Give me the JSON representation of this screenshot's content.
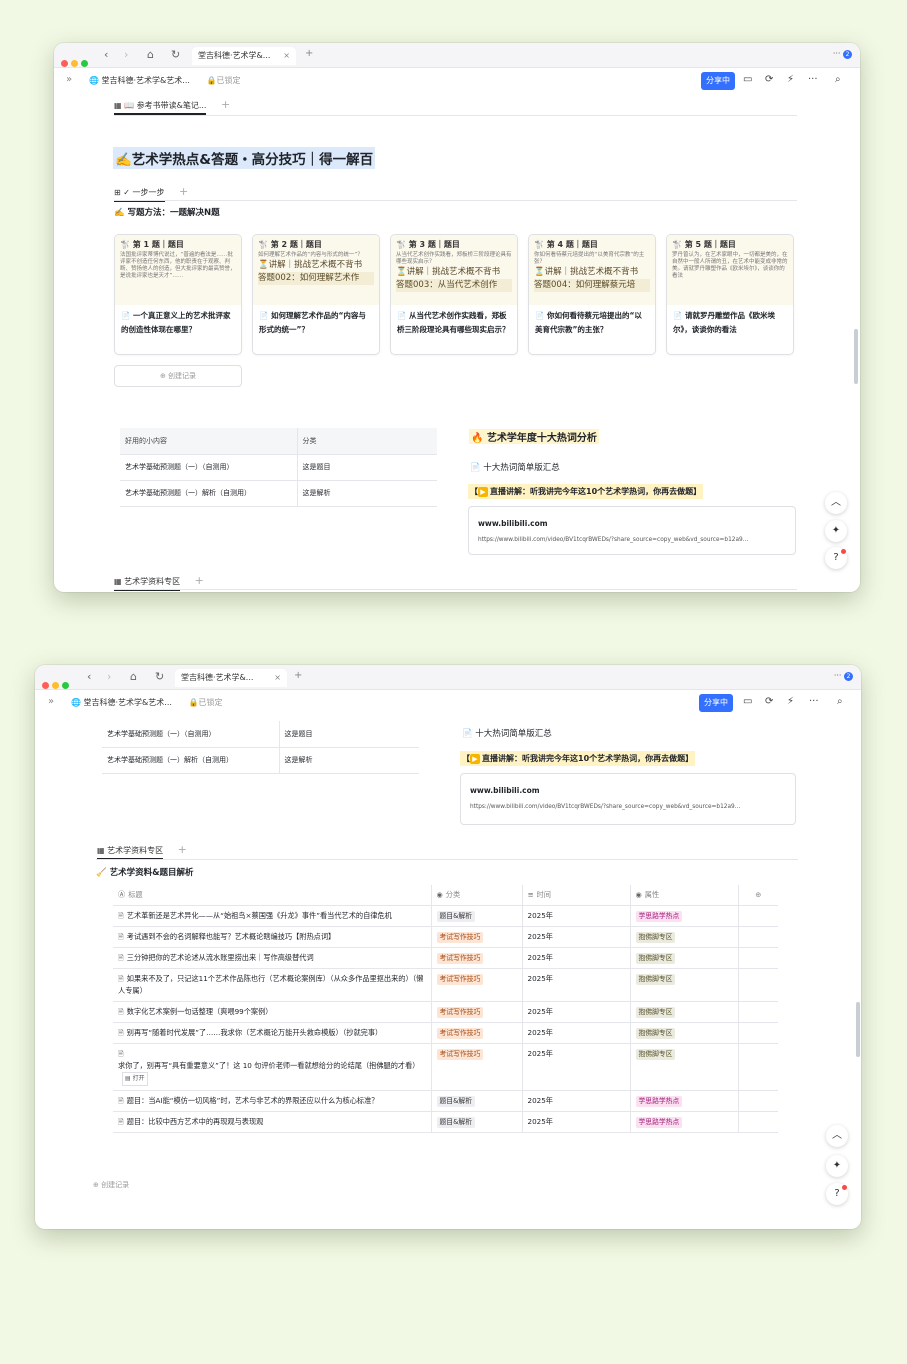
{
  "browser": {
    "tab_title": "堂吉科德·艺术学&...",
    "tab_title_2": "堂吉科德·艺术学&...",
    "notif_count": "2"
  },
  "toolbar": {
    "breadcrumb": "堂吉科德·艺术学&艺术...",
    "breadcrumb_2": "堂吉科德·艺术学&艺术...",
    "locked": "已锁定",
    "share": "分享中"
  },
  "window1": {
    "top_tab": "📖 参考书带读&笔记...",
    "title": "✍️艺术学热点&答题・高分技巧｜得一解百",
    "view_tab": "✓ 一步一步",
    "method": "✍️ 写题方法：一题解决N题",
    "cards": [
      {
        "head": "🐩 第 1 题｜题目",
        "text": "法国批评家蒂博代说过，“普遍的看法是……批评家不创造任何东西，他的职责在于观察、判断、赞扬他人的创造，但大批评家的最高赞誉，是说批评家也是天才”……",
        "big": "",
        "big2": "",
        "title": "📄 一个真正意义上的艺术批评家的创造性体现在哪里？"
      },
      {
        "head": "🐩 第 2 题｜题目",
        "text": "如何理解艺术作品的“内容与形式的统一”？",
        "big": "⏳讲解｜挑战艺术概不背书",
        "big2": "答题002：如何理解艺术作",
        "title": "📄 如何理解艺术作品的“内容与形式的统一”？"
      },
      {
        "head": "🐩 第 3 题｜题目",
        "text": "从当代艺术创作实践看，郑板桥三阶段理论具有哪些现实启示？",
        "big": "⏳讲解｜挑战艺术概不背书",
        "big2": "答题003：从当代艺术创作",
        "title": "📄 从当代艺术创作实践看，郑板桥三阶段理论具有哪些现实启示？"
      },
      {
        "head": "🐩 第 4 题｜题目",
        "text": "你如何看待蔡元培提出的“以美育代宗教”的主张？",
        "big": "⏳讲解｜挑战艺术概不背书",
        "big2": "答题004：如何理解蔡元培",
        "title": "📄 你如何看待蔡元培提出的“以美育代宗教”的主张？"
      },
      {
        "head": "🐩 第 5 题｜题目",
        "text": "罗丹曾认为，在艺术家眼中，一切都是美的，在自然中一般人所谓的丑，在艺术中能变成非常的美。请就罗丹雕塑作品《欧米埃尔》，谈谈你的看法",
        "big": "",
        "big2": "",
        "title": "📄 请就罗丹雕塑作品《欧米埃尔》，谈谈你的看法"
      }
    ],
    "create": "⊕ 创建记录",
    "mini_table": {
      "headers": [
        "好用的小内容",
        "分类"
      ],
      "rows": [
        [
          "艺术学基础预测题（一）（自测用）",
          "这是题目"
        ],
        [
          "艺术学基础预测题（一）解析（自测用）",
          "这是解析"
        ]
      ]
    },
    "hot_title": "🔥 艺术学年度十大热词分析",
    "doc_line": "📄 十大热词简单版汇总",
    "live": "直播讲解：听我讲完今年这10个艺术学热词，你再去做题】",
    "live_prefix": "【",
    "link_domain": "www.bilibili.com",
    "link_url": "https://www.bilibili.com/video/BV1tcqrBWEDs/?share_source=copy_web&vd_source=b12a9...",
    "bottom_tab": "艺术学资料专区"
  },
  "window2": {
    "mini_rows": [
      [
        "艺术学基础预测题（一）（自测用）",
        "这是题目"
      ],
      [
        "艺术学基础预测题（一）解析（自测用）",
        "这是解析"
      ]
    ],
    "doc_line": "📄 十大热词简单版汇总",
    "live_prefix": "【",
    "live": "直播讲解：听我讲完今年这10个艺术学热词，你再去做题】",
    "link_domain": "www.bilibili.com",
    "link_url": "https://www.bilibili.com/video/BV1tcqrBWEDs/?share_source=copy_web&vd_source=b12a9...",
    "view_tab": "艺术学资料专区",
    "section": "艺术学资料&题目解析",
    "columns": [
      "标题",
      "分类",
      "时间",
      "属性"
    ],
    "rows": [
      {
        "title": "艺术革新还是艺术异化——从“始祖鸟×蔡国强《升龙》事件”看当代艺术的自律危机",
        "cat": "题目&解析",
        "cat_style": "gray",
        "time": "2025年",
        "attr": "学思路学热点",
        "attr_style": "pink",
        "open": ""
      },
      {
        "title": "考试遇到不会的名词解释也能写？艺术概论瞎编技巧【附热点词】",
        "cat": "考试写作技巧",
        "cat_style": "orange",
        "time": "2025年",
        "attr": "抱佛脚专区",
        "attr_style": "olive",
        "open": ""
      },
      {
        "title": "三分钟把你的艺术论述从流水账里捞出来｜写作高级替代词",
        "cat": "考试写作技巧",
        "cat_style": "orange",
        "time": "2025年",
        "attr": "抱佛脚专区",
        "attr_style": "olive",
        "open": ""
      },
      {
        "title": "如果来不及了，只记这11个艺术作品陈也行（艺术概论案例库）（从众多作品里抠出来的）（懒人专属）",
        "cat": "考试写作技巧",
        "cat_style": "orange",
        "time": "2025年",
        "attr": "抱佛脚专区",
        "attr_style": "olive",
        "open": ""
      },
      {
        "title": "数字化艺术案例一句话整理（爽喂99个案例）",
        "cat": "考试写作技巧",
        "cat_style": "orange",
        "time": "2025年",
        "attr": "抱佛脚专区",
        "attr_style": "olive",
        "open": ""
      },
      {
        "title": "别再写“随着时代发展”了……我求你（艺术概论万能开头救命模版）（抄就完事）",
        "cat": "考试写作技巧",
        "cat_style": "orange",
        "time": "2025年",
        "attr": "抱佛脚专区",
        "attr_style": "olive",
        "open": ""
      },
      {
        "title": "求你了，别再写“具有重要意义”了！这 10 句评价老师一看就想给分的论结尾（抱佛腿的才看）",
        "cat": "考试写作技巧",
        "cat_style": "orange",
        "time": "2025年",
        "attr": "抱佛脚专区",
        "attr_style": "olive",
        "open": "打开"
      },
      {
        "title": "题目：当AI能“模仿一切风格”时，艺术与非艺术的界限还应以什么为核心标准？",
        "cat": "题目&解析",
        "cat_style": "gray",
        "time": "2025年",
        "attr": "学思路学热点",
        "attr_style": "pink",
        "open": ""
      },
      {
        "title": "题目：比较中西方艺术中的再现观与表现观",
        "cat": "题目&解析",
        "cat_style": "gray",
        "time": "2025年",
        "attr": "学思路学热点",
        "attr_style": "pink",
        "open": ""
      }
    ],
    "create": "⊕ 创建记录"
  }
}
